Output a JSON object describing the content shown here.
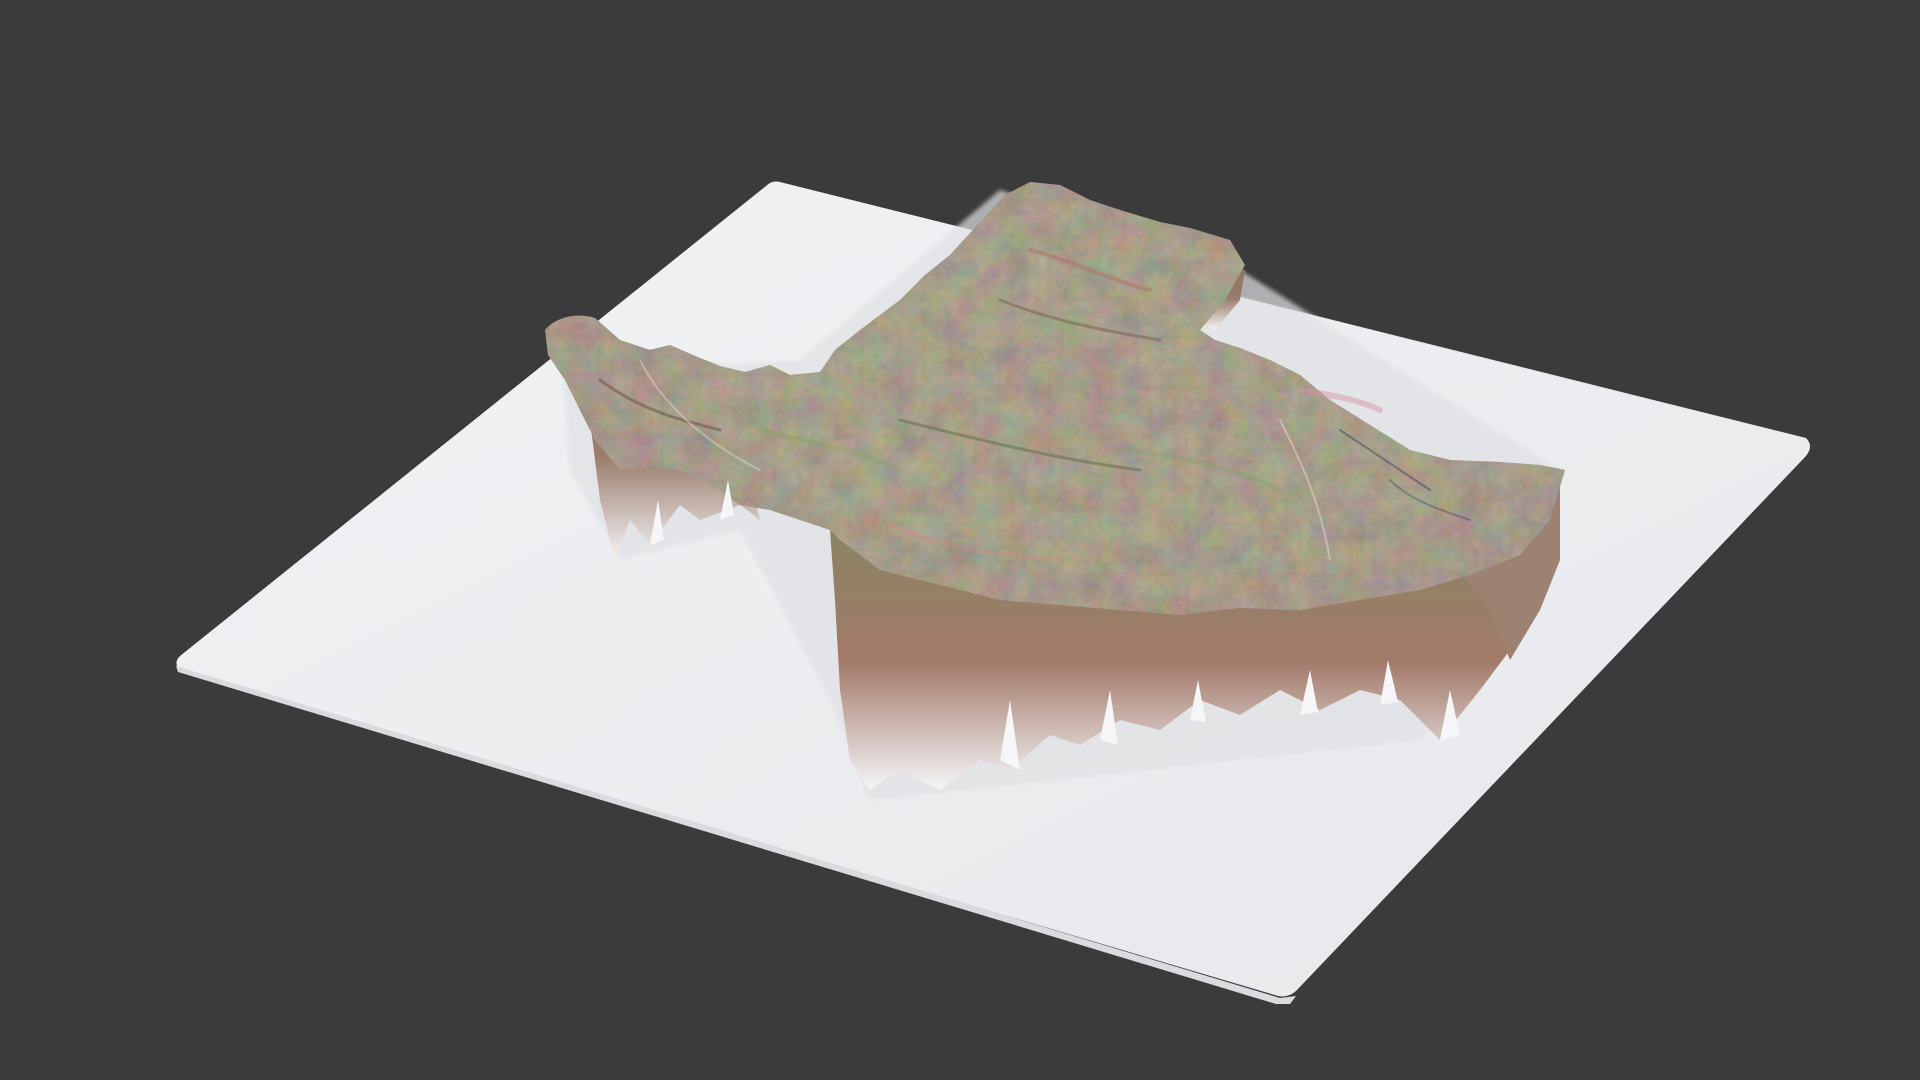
{
  "scene": {
    "background_color": "#3b3b3b",
    "base_plate_color": "#eef0f2",
    "terrain_palette": [
      "#8a6a5a",
      "#9a7a66",
      "#7d8a5e",
      "#8fa06a",
      "#b07070",
      "#a58a7a",
      "#6e7a55",
      "#c48a86",
      "#5f6a4c"
    ],
    "terrain_edge_color": "#f4f4f6"
  }
}
